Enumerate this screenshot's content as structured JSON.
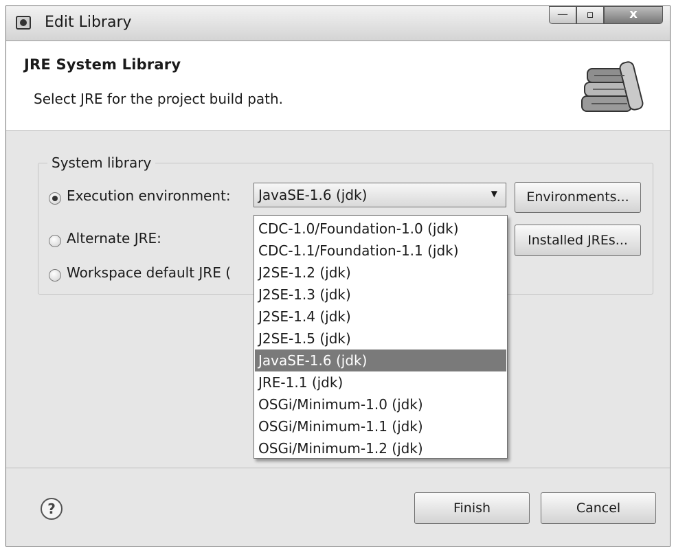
{
  "window": {
    "title": "Edit Library",
    "min_label": "—",
    "max_label": "▫",
    "close_label": "x"
  },
  "header": {
    "title": "JRE System Library",
    "description": "Select JRE for the project build path.",
    "icon": "library-books-icon"
  },
  "group": {
    "title": "System library",
    "options": [
      {
        "label": "Execution environment:",
        "checked": true
      },
      {
        "label": "Alternate JRE:",
        "checked": false
      },
      {
        "label": "Workspace default JRE (",
        "checked": false
      }
    ]
  },
  "combo": {
    "value": "JavaSE-1.6 (jdk)"
  },
  "buttons": {
    "environments": "Environments...",
    "installed_jres": "Installed JREs...",
    "finish": "Finish",
    "cancel": "Cancel"
  },
  "dropdown": {
    "items": [
      "CDC-1.0/Foundation-1.0 (jdk)",
      "CDC-1.1/Foundation-1.1 (jdk)",
      "J2SE-1.2 (jdk)",
      "J2SE-1.3 (jdk)",
      "J2SE-1.4 (jdk)",
      "J2SE-1.5 (jdk)",
      "JavaSE-1.6 (jdk)",
      "JRE-1.1 (jdk)",
      "OSGi/Minimum-1.0 (jdk)",
      "OSGi/Minimum-1.1 (jdk)",
      "OSGi/Minimum-1.2 (jdk)"
    ],
    "selected": "JavaSE-1.6 (jdk)"
  },
  "help": {
    "label": "?"
  },
  "colors": {
    "dialog_bg": "#e6e6e6",
    "header_bg": "#ffffff",
    "selection": "#7a7a7a"
  }
}
